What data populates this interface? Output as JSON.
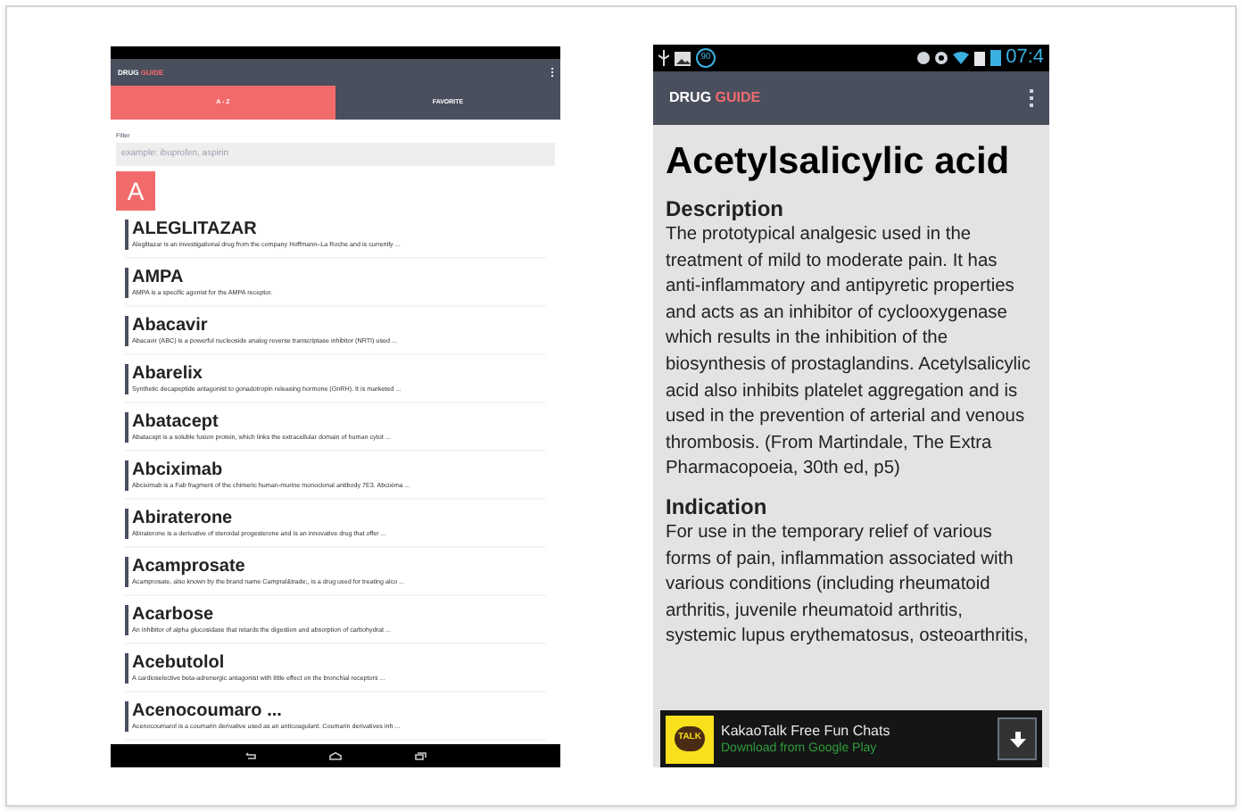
{
  "list_screen": {
    "app_title": {
      "brand": "DRUG",
      "accent": "GUIDE"
    },
    "tabs": [
      {
        "label": "A - Z",
        "selected": true
      },
      {
        "label": "FAVORITE",
        "selected": false
      }
    ],
    "filter": {
      "label": "Filter",
      "placeholder": "example: ibuprofen, aspirin"
    },
    "section_letter": "A",
    "drugs": [
      {
        "name": "ALEGLITAZAR",
        "summary": "Aleglitazar is an investigational drug from the company Hoffmann–La Roche and is currently ..."
      },
      {
        "name": "AMPA",
        "summary": "AMPA is a specific agonist for the AMPA receptor."
      },
      {
        "name": "Abacavir",
        "summary": "Abacavir (ABC) is a powerful nucleoside analog reverse transcriptase inhibitor (NRTI) used ..."
      },
      {
        "name": "Abarelix",
        "summary": "Synthetic decapeptide antagonist to gonadotropin releasing hormone (GnRH). It is marketed ..."
      },
      {
        "name": "Abatacept",
        "summary": "Abatacept is a soluble fusion protein, which links the extracellular domain of human cytot ..."
      },
      {
        "name": "Abciximab",
        "summary": "Abciximab is a Fab fragment of the chimeric human-murine monoclonal antibody 7E3. Abcixima ..."
      },
      {
        "name": "Abiraterone",
        "summary": "Abiraterone is a derivative of steroidal progesterone and is an innovative drug that offer ..."
      },
      {
        "name": "Acamprosate",
        "summary": "Acamprosate, also known by the brand name Campral&trade;, is a drug used for treating alco ..."
      },
      {
        "name": "Acarbose",
        "summary": "An inhibitor of alpha glucosidase that retards the digestion and absorption of carbohydrat ..."
      },
      {
        "name": "Acebutolol",
        "summary": "A cardioselective beta-adrenergic antagonist with little effect on the bronchial receptors ..."
      },
      {
        "name": "Acenocoumaro ...",
        "summary": "Acenocoumarol is a coumarin derivative used as an anticoagulant. Coumarin derivatives inh ..."
      }
    ]
  },
  "detail_screen": {
    "status_bar": {
      "time": "07:4",
      "badge": "90"
    },
    "app_title": {
      "brand": "DRUG",
      "accent": "GUIDE"
    },
    "drug_name": "Acetylsalicylic acid",
    "sections": [
      {
        "heading": "Description",
        "body": "The prototypical analgesic used in the treatment of mild to moderate pain. It has anti-inflammatory and antipyretic properties and acts as an inhibitor of cyclooxygenase which results in the inhibition of the biosynthesis of prostaglandins. Acetylsalicylic acid also inhibits platelet aggregation and is used in the prevention of arterial and venous thrombosis. (From Martindale, The Extra Pharmacopoeia, 30th ed, p5)"
      },
      {
        "heading": "Indication",
        "body": "For use in the temporary relief of various forms of pain, inflammation associated with various conditions (including rheumatoid arthritis, juvenile rheumatoid arthritis, systemic lupus erythematosus, osteoarthritis,"
      }
    ],
    "ad": {
      "logo": "TALK",
      "title": "KakaoTalk Free Fun Chats",
      "subtitle": "Download from Google Play"
    }
  }
}
